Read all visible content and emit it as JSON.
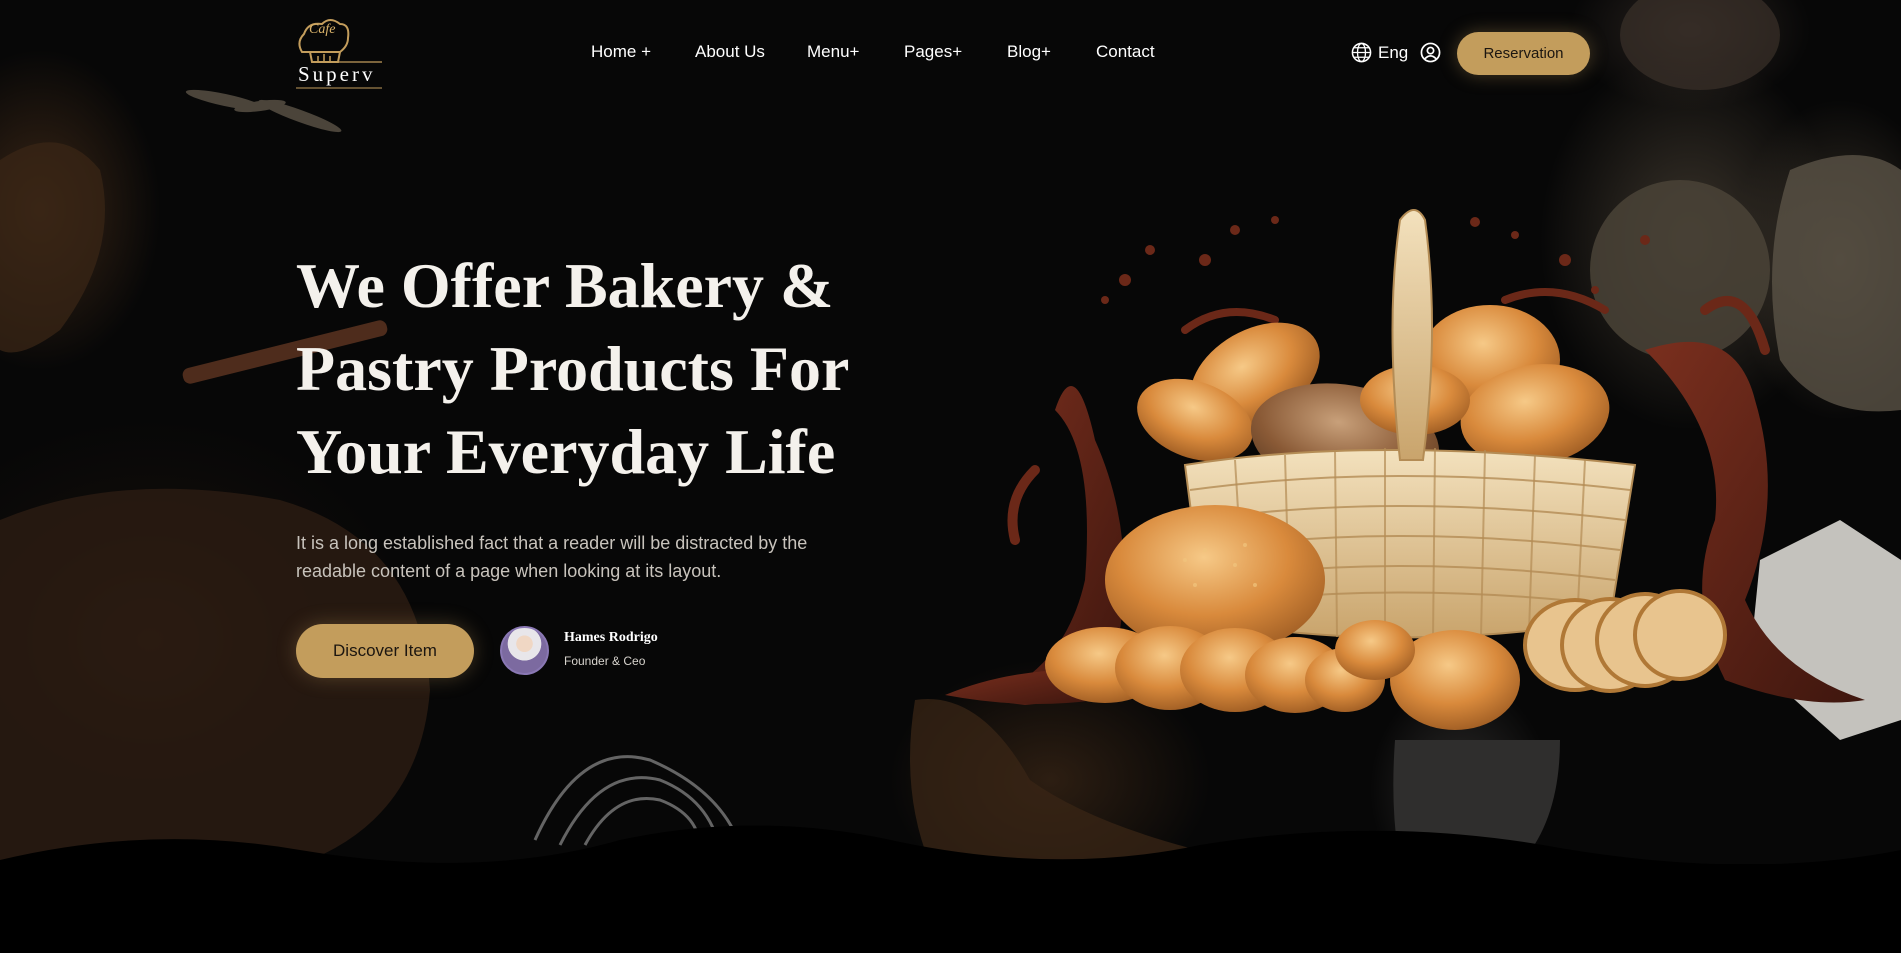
{
  "header": {
    "logo_badge": "Cafe",
    "logo_text": "Superv",
    "nav": [
      {
        "label": "Home +"
      },
      {
        "label": "About Us"
      },
      {
        "label": "Menu+"
      },
      {
        "label": "Pages+"
      },
      {
        "label": "Blog+"
      },
      {
        "label": "Contact"
      }
    ],
    "language": "Eng",
    "reservation_label": "Reservation"
  },
  "hero": {
    "title_lines": [
      "We Offer Bakery &",
      "Pastry Products For",
      "Your Everyday Life"
    ],
    "description_lines": [
      "It is a long established fact that a reader will be distracted by the",
      "readable content of a page when looking at its layout."
    ],
    "discover_label": "Discover Item",
    "author": {
      "name": "Hames Rodrigo",
      "role": "Founder & Ceo"
    }
  },
  "icons": {
    "globe": "globe-icon",
    "user": "user-icon",
    "logo": "chef-hat-icon"
  },
  "colors": {
    "accent": "#c39d5c",
    "background": "#070707",
    "text": "#f4f1ec",
    "muted_text": "#c8c3bc"
  }
}
